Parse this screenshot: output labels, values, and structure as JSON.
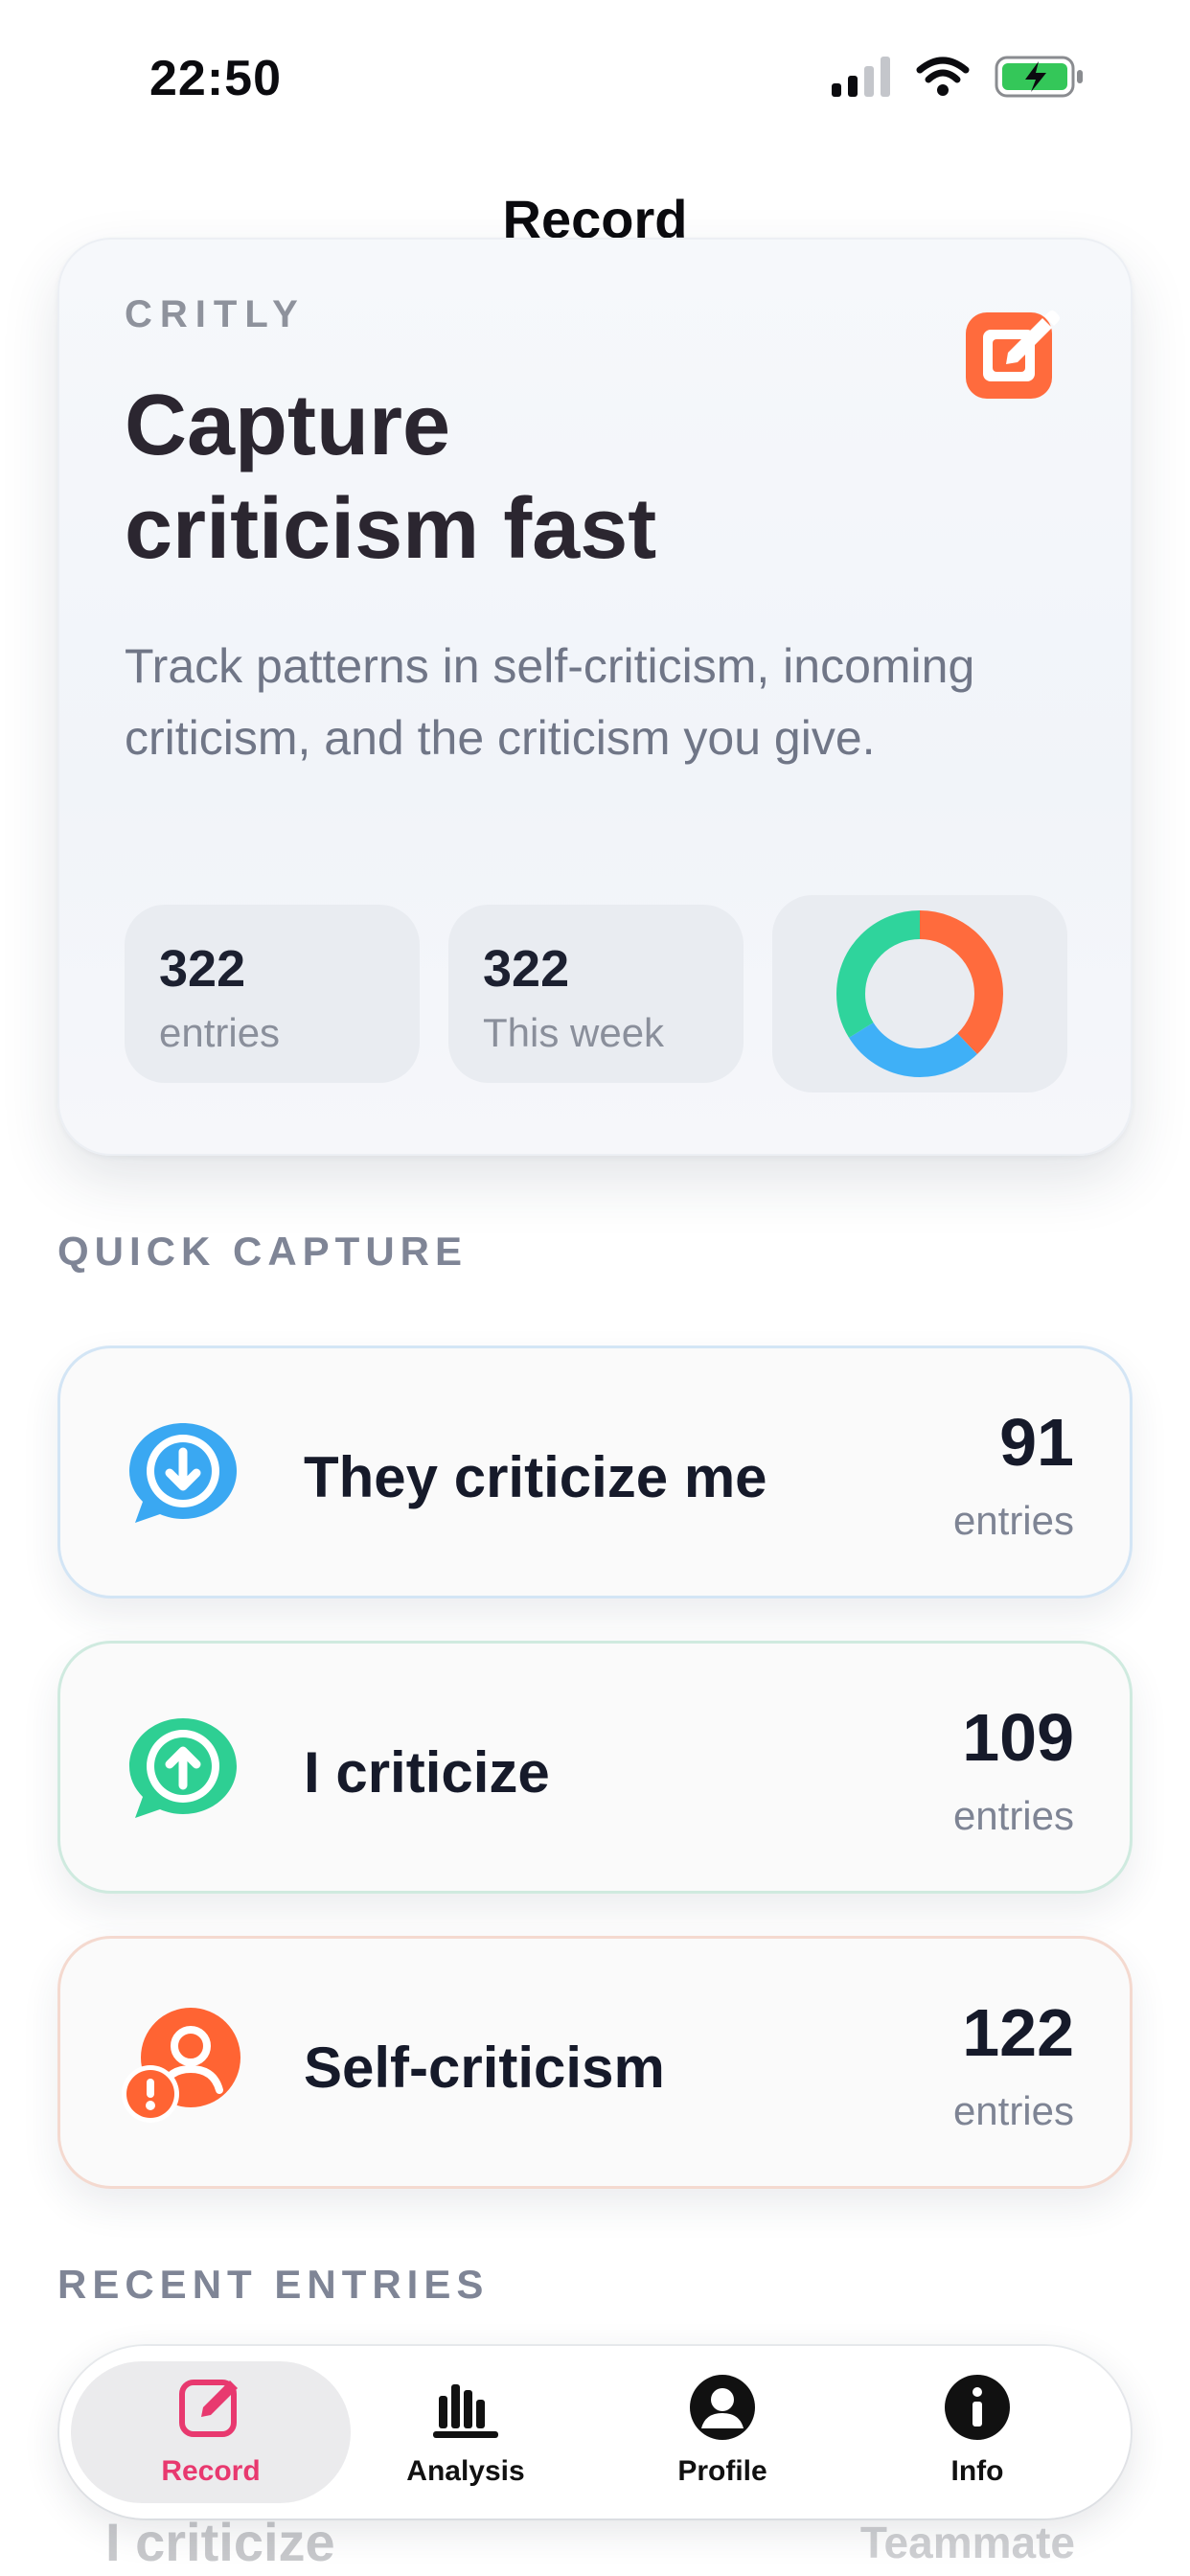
{
  "status_bar": {
    "time": "22:50"
  },
  "nav": {
    "title": "Record"
  },
  "hero": {
    "brand": "CRITLY",
    "headline_line1": "Capture",
    "headline_line2": "criticism fast",
    "subtitle": "Track patterns in self-criticism, incoming criticism, and the criticism you give.",
    "stats": [
      {
        "value": "322",
        "label": "entries"
      },
      {
        "value": "322",
        "label": "This week"
      }
    ],
    "donut": [
      {
        "name": "orange",
        "color": "#ff6b3d",
        "value": 122
      },
      {
        "name": "blue",
        "color": "#3fb0f7",
        "value": 91
      },
      {
        "name": "green",
        "color": "#2fd49c",
        "value": 109
      }
    ]
  },
  "sections": {
    "quick_capture": "QUICK CAPTURE",
    "recent_entries": "RECENT ENTRIES"
  },
  "capture": [
    {
      "title": "They criticize me",
      "count": "91",
      "unit": "entries",
      "color": "#3aa8f2",
      "icon": "chat-down-arrow-icon"
    },
    {
      "title": "I criticize",
      "count": "109",
      "unit": "entries",
      "color": "#2ecf93",
      "icon": "chat-up-arrow-icon"
    },
    {
      "title": "Self-criticism",
      "count": "122",
      "unit": "entries",
      "color": "#ff6433",
      "icon": "person-alert-icon"
    }
  ],
  "recent_peek": {
    "left": "I criticize",
    "right": "Teammate"
  },
  "tabs": [
    {
      "label": "Record",
      "icon": "edit-square-icon",
      "active": true
    },
    {
      "label": "Analysis",
      "icon": "bar-chart-icon",
      "active": false
    },
    {
      "label": "Profile",
      "icon": "person-circle-icon",
      "active": false
    },
    {
      "label": "Info",
      "icon": "info-circle-icon",
      "active": false
    }
  ],
  "colors": {
    "accent": "#e8396f",
    "edit_orange": "#ff6b3d"
  }
}
